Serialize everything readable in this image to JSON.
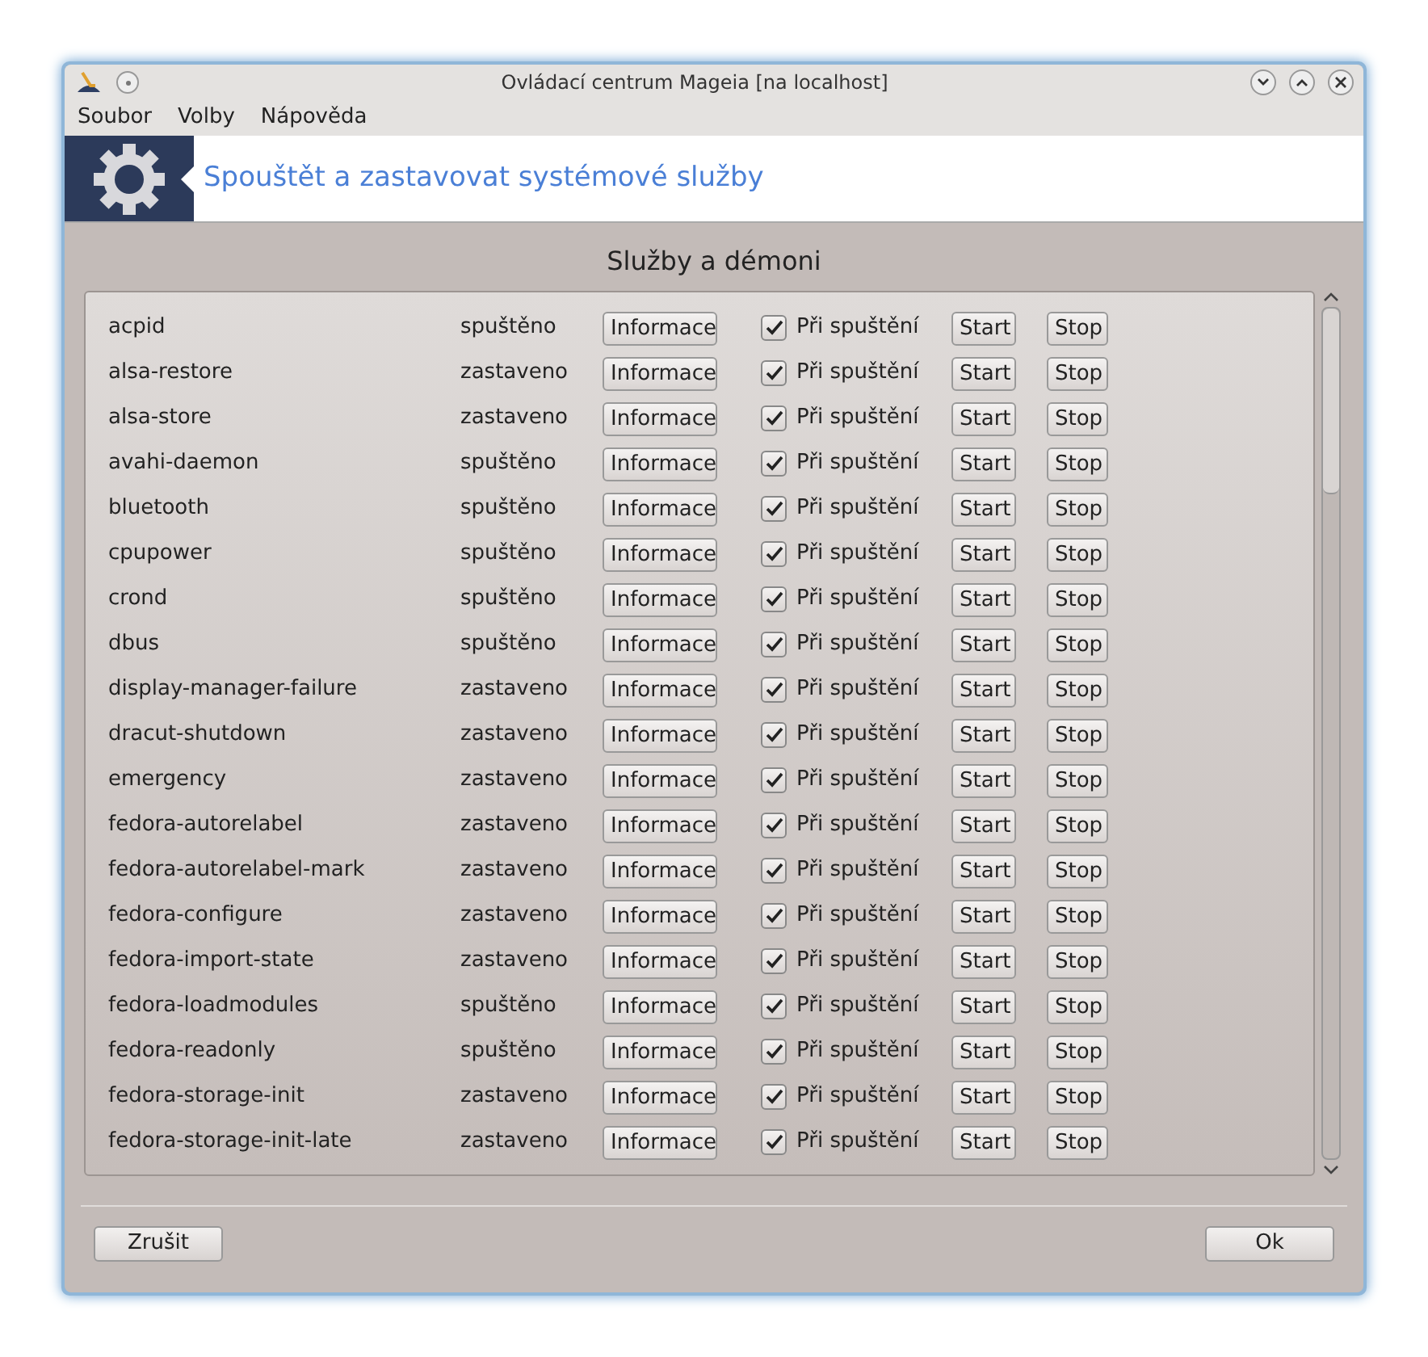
{
  "window": {
    "title": "Ovládací centrum Mageia  [na localhost]"
  },
  "menu": [
    "Soubor",
    "Volby",
    "Nápověda"
  ],
  "header": {
    "title": "Spouštět a zastavovat systémové služby"
  },
  "section_title": "Služby a démoni",
  "services": [
    {
      "name": "acpid",
      "status": "spuštěno",
      "info": "Informace",
      "boot_label": "Při spuštění",
      "on_boot": true,
      "start": "Start",
      "stop": "Stop"
    },
    {
      "name": "alsa-restore",
      "status": "zastaveno",
      "info": "Informace",
      "boot_label": "Při spuštění",
      "on_boot": true,
      "start": "Start",
      "stop": "Stop"
    },
    {
      "name": "alsa-store",
      "status": "zastaveno",
      "info": "Informace",
      "boot_label": "Při spuštění",
      "on_boot": true,
      "start": "Start",
      "stop": "Stop"
    },
    {
      "name": "avahi-daemon",
      "status": "spuštěno",
      "info": "Informace",
      "boot_label": "Při spuštění",
      "on_boot": true,
      "start": "Start",
      "stop": "Stop"
    },
    {
      "name": "bluetooth",
      "status": "spuštěno",
      "info": "Informace",
      "boot_label": "Při spuštění",
      "on_boot": true,
      "start": "Start",
      "stop": "Stop"
    },
    {
      "name": "cpupower",
      "status": "spuštěno",
      "info": "Informace",
      "boot_label": "Při spuštění",
      "on_boot": true,
      "start": "Start",
      "stop": "Stop"
    },
    {
      "name": "crond",
      "status": "spuštěno",
      "info": "Informace",
      "boot_label": "Při spuštění",
      "on_boot": true,
      "start": "Start",
      "stop": "Stop"
    },
    {
      "name": "dbus",
      "status": "spuštěno",
      "info": "Informace",
      "boot_label": "Při spuštění",
      "on_boot": true,
      "start": "Start",
      "stop": "Stop"
    },
    {
      "name": "display-manager-failure",
      "status": "zastaveno",
      "info": "Informace",
      "boot_label": "Při spuštění",
      "on_boot": true,
      "start": "Start",
      "stop": "Stop"
    },
    {
      "name": "dracut-shutdown",
      "status": "zastaveno",
      "info": "Informace",
      "boot_label": "Při spuštění",
      "on_boot": true,
      "start": "Start",
      "stop": "Stop"
    },
    {
      "name": "emergency",
      "status": "zastaveno",
      "info": "Informace",
      "boot_label": "Při spuštění",
      "on_boot": true,
      "start": "Start",
      "stop": "Stop"
    },
    {
      "name": "fedora-autorelabel",
      "status": "zastaveno",
      "info": "Informace",
      "boot_label": "Při spuštění",
      "on_boot": true,
      "start": "Start",
      "stop": "Stop"
    },
    {
      "name": "fedora-autorelabel-mark",
      "status": "zastaveno",
      "info": "Informace",
      "boot_label": "Při spuštění",
      "on_boot": true,
      "start": "Start",
      "stop": "Stop"
    },
    {
      "name": "fedora-configure",
      "status": "zastaveno",
      "info": "Informace",
      "boot_label": "Při spuštění",
      "on_boot": true,
      "start": "Start",
      "stop": "Stop"
    },
    {
      "name": "fedora-import-state",
      "status": "zastaveno",
      "info": "Informace",
      "boot_label": "Při spuštění",
      "on_boot": true,
      "start": "Start",
      "stop": "Stop"
    },
    {
      "name": "fedora-loadmodules",
      "status": "spuštěno",
      "info": "Informace",
      "boot_label": "Při spuštění",
      "on_boot": true,
      "start": "Start",
      "stop": "Stop"
    },
    {
      "name": "fedora-readonly",
      "status": "spuštěno",
      "info": "Informace",
      "boot_label": "Při spuštění",
      "on_boot": true,
      "start": "Start",
      "stop": "Stop"
    },
    {
      "name": "fedora-storage-init",
      "status": "zastaveno",
      "info": "Informace",
      "boot_label": "Při spuštění",
      "on_boot": true,
      "start": "Start",
      "stop": "Stop"
    },
    {
      "name": "fedora-storage-init-late",
      "status": "zastaveno",
      "info": "Informace",
      "boot_label": "Při spuštění",
      "on_boot": true,
      "start": "Start",
      "stop": "Stop"
    }
  ],
  "buttons": {
    "cancel": "Zrušit",
    "ok": "Ok"
  }
}
